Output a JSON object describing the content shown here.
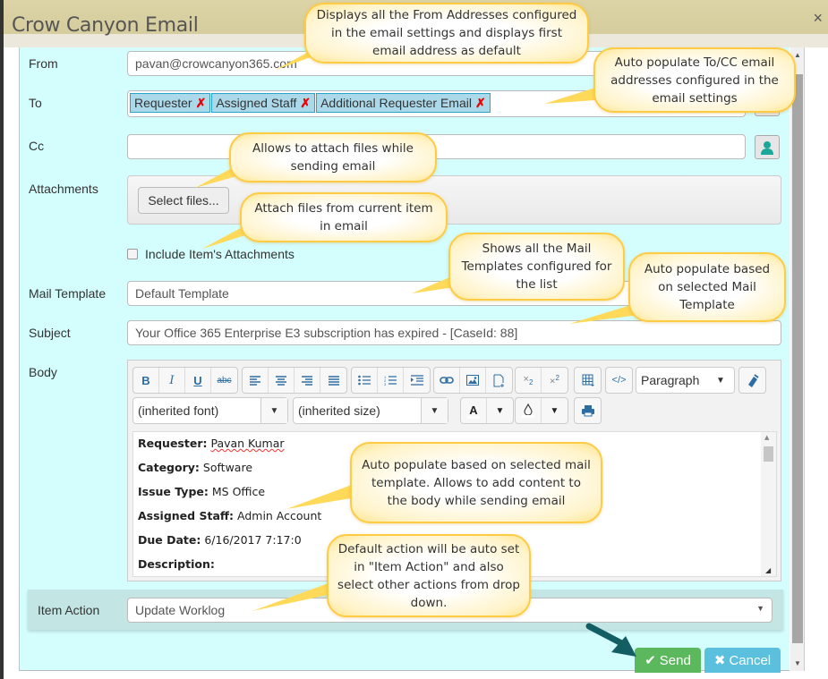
{
  "window": {
    "title": "Crow Canyon Email",
    "close_icon": "×"
  },
  "form": {
    "from": {
      "label": "From",
      "value": "pavan@crowcanyon365.com"
    },
    "to": {
      "label": "To",
      "tags": [
        {
          "text": "Requester",
          "remove": "✗"
        },
        {
          "text": "Assigned Staff",
          "remove": "✗"
        },
        {
          "text": "Additional Requester Email",
          "remove": "✗"
        }
      ]
    },
    "cc": {
      "label": "Cc",
      "value": ""
    },
    "attachments": {
      "label": "Attachments",
      "select_button": "Select files...",
      "include_checkbox_label": "Include Item's Attachments",
      "include_checked": false
    },
    "mail_template": {
      "label": "Mail Template",
      "value": "Default Template"
    },
    "subject": {
      "label": "Subject",
      "value": "Your Office 365 Enterprise E3 subscription has expired - [CaseId: 88]"
    },
    "body": {
      "label": "Body",
      "toolbar": {
        "bold": "B",
        "italic": "I",
        "underline": "U",
        "strikethrough": "abc",
        "format_select": "Paragraph",
        "font_select": "(inherited font)",
        "size_select": "(inherited size)",
        "font_color": "A"
      },
      "content": [
        {
          "key": "Requester:",
          "value": "Pavan Kumar"
        },
        {
          "key": "Category:",
          "value": "Software"
        },
        {
          "key": "Issue Type:",
          "value": "MS Office"
        },
        {
          "key": "Assigned Staff:",
          "value": "Admin Account"
        },
        {
          "key": "Due Date:",
          "value": "6/16/2017 7:17:0"
        },
        {
          "key": "Description:",
          "value": ""
        }
      ]
    },
    "item_action": {
      "label": "Item Action",
      "value": "Update Worklog"
    }
  },
  "buttons": {
    "send": "Send",
    "cancel": "Cancel"
  },
  "callouts": [
    "Displays all the From Addresses configured in the email settings and displays first email address as default",
    "Auto populate To/CC email addresses configured in the email settings",
    "Allows to attach files while sending email",
    "Attach files from current item in email",
    "Shows all the Mail Templates configured for the list",
    "Auto populate based on selected Mail Template",
    "Auto populate based on selected mail template. Allows to add content to the body while sending email",
    "Default action will be auto set in \"Item Action\" and also select other actions from drop down."
  ],
  "colors": {
    "form_background": "#d4fdfd",
    "titlebar": "#d6cd9e",
    "send": "#5cb85c",
    "cancel": "#5bc0de",
    "callout_border": "#ffcb45",
    "arrow": "#135e63",
    "tag_bg": "#abd9ea"
  }
}
